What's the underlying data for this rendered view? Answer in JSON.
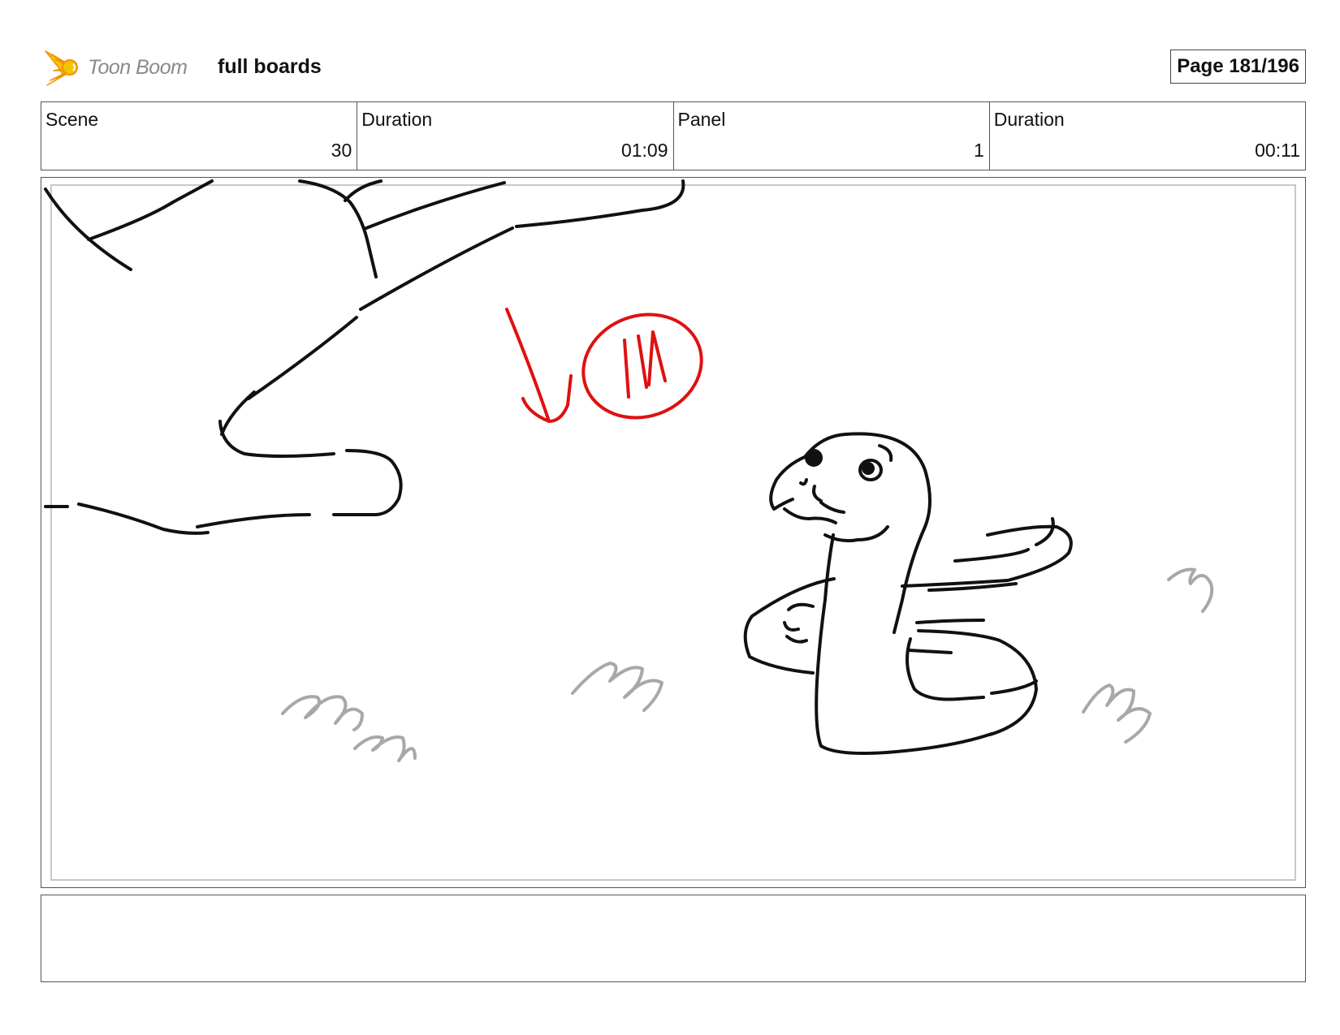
{
  "header": {
    "logo_text": "Toon Boom",
    "project_title": "full boards",
    "page_label": "Page 181/196"
  },
  "info": [
    {
      "label": "Scene",
      "value": "30"
    },
    {
      "label": "Duration",
      "value": "01:09"
    },
    {
      "label": "Panel",
      "value": "1"
    },
    {
      "label": "Duration",
      "value": "00:11"
    }
  ],
  "panel": {
    "annotation_text": "IN",
    "colors": {
      "line": "#111111",
      "annotation": "#e01010",
      "grass": "#a8a8a8"
    }
  },
  "notes": {
    "text": ""
  },
  "colors": {
    "logo_yellow": "#f5c400",
    "logo_orange": "#f29100",
    "border": "#555555"
  }
}
